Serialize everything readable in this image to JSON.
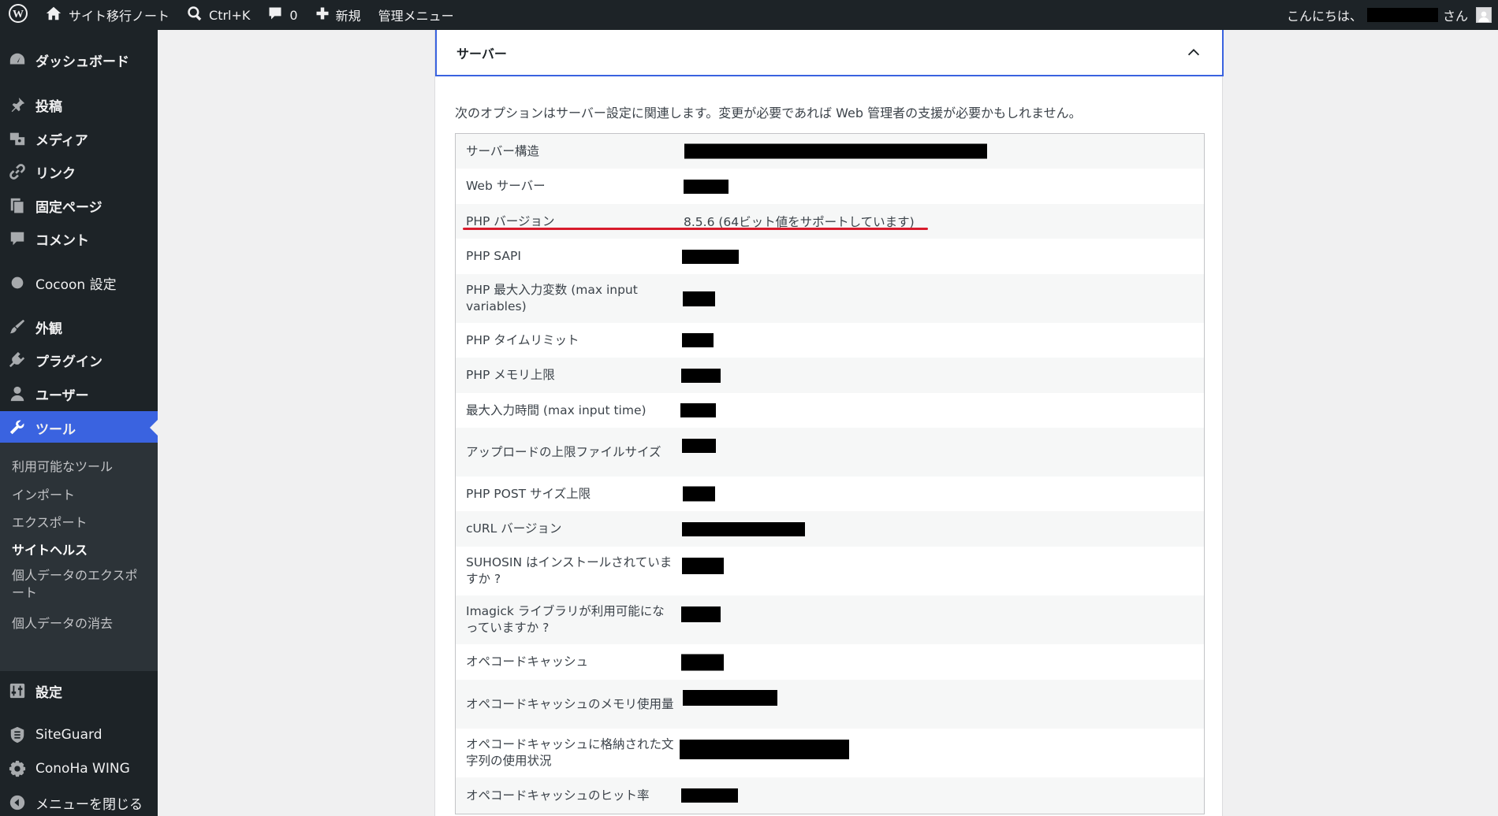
{
  "admin_bar": {
    "site_name": "サイト移行ノート",
    "search_shortcut": "Ctrl+K",
    "comments_count": "0",
    "new_label": "新規",
    "admin_menu_label": "管理メニュー",
    "greeting": "こんにちは、",
    "greeting_suffix": "さん"
  },
  "sidebar": {
    "items": [
      {
        "label": "ダッシュボード",
        "icon": "dashboard-icon"
      },
      {
        "label": "投稿",
        "icon": "pin-icon"
      },
      {
        "label": "メディア",
        "icon": "media-icon"
      },
      {
        "label": "リンク",
        "icon": "link-icon"
      },
      {
        "label": "固定ページ",
        "icon": "page-icon"
      },
      {
        "label": "コメント",
        "icon": "comment-icon"
      },
      {
        "label": "Cocoon 設定",
        "icon": "circle-icon"
      },
      {
        "label": "外観",
        "icon": "brush-icon"
      },
      {
        "label": "プラグイン",
        "icon": "plugin-icon"
      },
      {
        "label": "ユーザー",
        "icon": "user-icon"
      },
      {
        "label": "ツール",
        "icon": "wrench-icon"
      },
      {
        "label": "設定",
        "icon": "settings-icon"
      },
      {
        "label": "SiteGuard",
        "icon": "siteguard-icon"
      },
      {
        "label": "ConoHa WING",
        "icon": "gear-icon"
      },
      {
        "label": "メニューを閉じる",
        "icon": "collapse-icon"
      }
    ],
    "tools_submenu": [
      {
        "label": "利用可能なツール"
      },
      {
        "label": "インポート"
      },
      {
        "label": "エクスポート"
      },
      {
        "label": "サイトヘルス"
      },
      {
        "label": "個人データのエクスポート"
      },
      {
        "label": "個人データの消去"
      }
    ]
  },
  "panel": {
    "section_title": "サーバー",
    "description": "次のオプションはサーバー設定に関連します。変更が必要であれば Web 管理者の支援が必要かもしれません。",
    "rows": [
      {
        "key": "サーバー構造",
        "value": ""
      },
      {
        "key": "Web サーバー",
        "value": ""
      },
      {
        "key": "PHP バージョン",
        "value": "8.5.6 (64ビット値をサポートしています)"
      },
      {
        "key": "PHP SAPI",
        "value": ""
      },
      {
        "key": "PHP 最大入力変数 (max input variables)",
        "value": ""
      },
      {
        "key": "PHP タイムリミット",
        "value": ""
      },
      {
        "key": "PHP メモリ上限",
        "value": ""
      },
      {
        "key": "最大入力時間 (max input time)",
        "value": ""
      },
      {
        "key": "アップロードの上限ファイルサイズ",
        "value": ""
      },
      {
        "key": "PHP POST サイズ上限",
        "value": ""
      },
      {
        "key": "cURL バージョン",
        "value": ""
      },
      {
        "key": "SUHOSIN はインストールされていますか ?",
        "value": ""
      },
      {
        "key": "Imagick ライブラリが利用可能になっていますか ?",
        "value": ""
      },
      {
        "key": "オペコードキャッシュ",
        "value": ""
      },
      {
        "key": "オペコードキャッシュのメモリ使用量",
        "value": ""
      },
      {
        "key": "オペコードキャッシュに格納された文字列の使用状況",
        "value": ""
      },
      {
        "key": "オペコードキャッシュのヒット率",
        "value": ""
      }
    ]
  },
  "colors": {
    "admin_bg": "#1d2327",
    "active_menu": "#3a63e0",
    "highlight_underline": "#d81b2c"
  }
}
